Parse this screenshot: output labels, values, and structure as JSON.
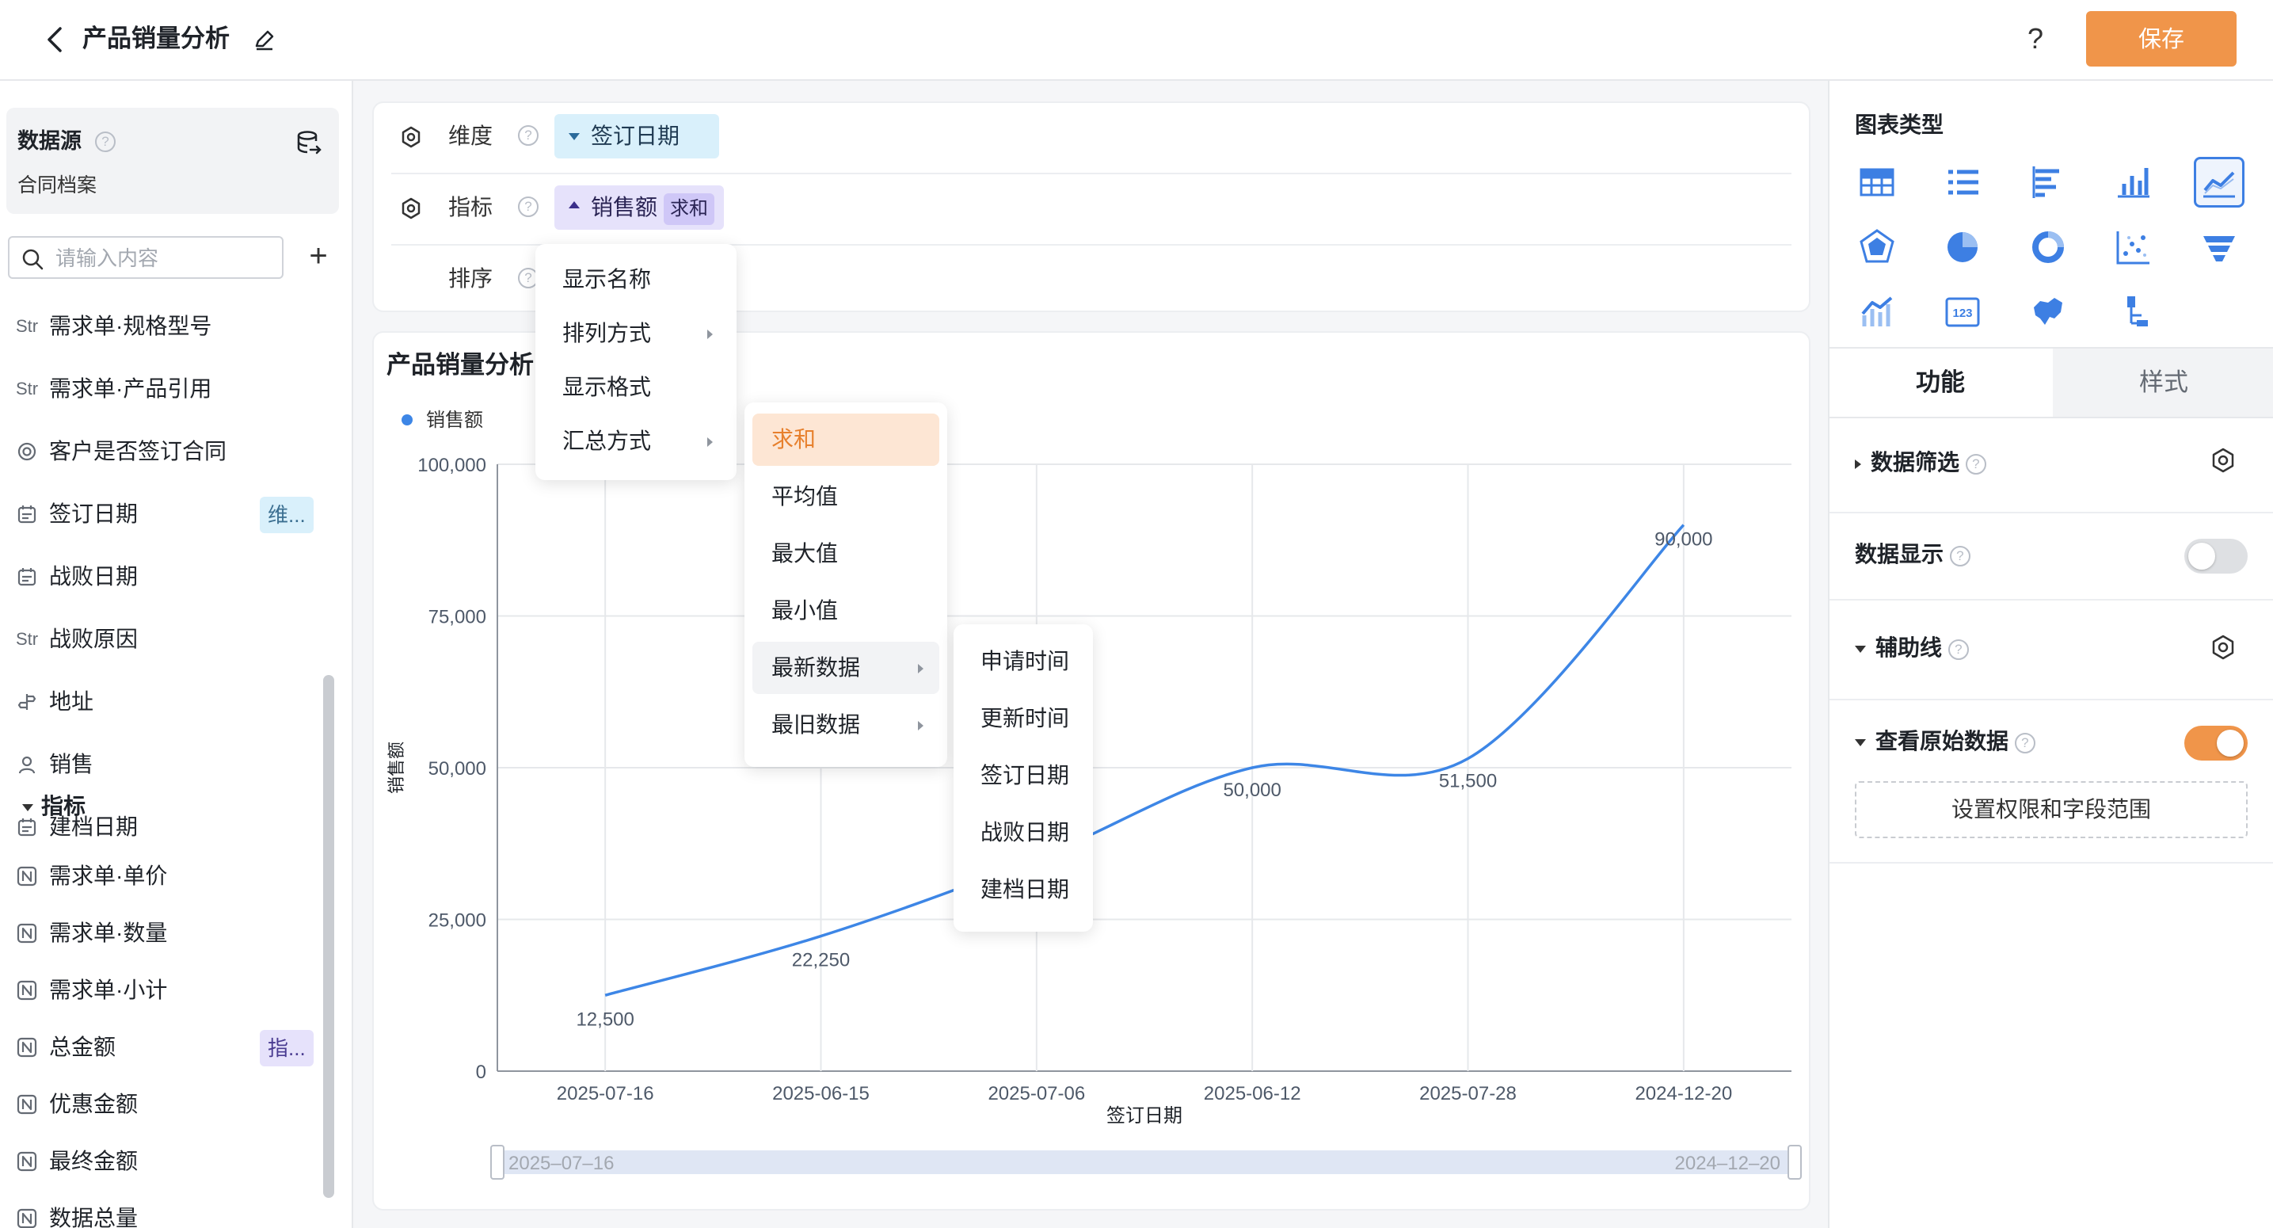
{
  "header": {
    "title": "产品销量分析",
    "help": "?",
    "save_label": "保存"
  },
  "datasource": {
    "title": "数据源",
    "help": "?",
    "name": "合同档案"
  },
  "search": {
    "placeholder": "请输入内容"
  },
  "fields": [
    {
      "type": "Str",
      "label": "需求单·规格型号",
      "tag": ""
    },
    {
      "type": "Str",
      "label": "需求单·产品引用",
      "tag": ""
    },
    {
      "type": "radio",
      "label": "客户是否签订合同",
      "tag": ""
    },
    {
      "type": "date",
      "label": "签订日期",
      "tag": "维..."
    },
    {
      "type": "date",
      "label": "战败日期",
      "tag": ""
    },
    {
      "type": "Str",
      "label": "战败原因",
      "tag": ""
    },
    {
      "type": "address",
      "label": "地址",
      "tag": ""
    },
    {
      "type": "user",
      "label": "销售",
      "tag": ""
    },
    {
      "type": "date",
      "label": "建档日期",
      "tag": ""
    }
  ],
  "metrics_group": {
    "title": "指标"
  },
  "metrics": [
    {
      "label": "需求单·单价",
      "tag": ""
    },
    {
      "label": "需求单·数量",
      "tag": ""
    },
    {
      "label": "需求单·小计",
      "tag": ""
    },
    {
      "label": "总金额",
      "tag": "指..."
    },
    {
      "label": "优惠金额",
      "tag": ""
    },
    {
      "label": "最终金额",
      "tag": ""
    },
    {
      "label": "数据总量",
      "tag": ""
    }
  ],
  "config": {
    "dimension_label": "维度",
    "dimension_value": "签订日期",
    "metric_label": "指标",
    "metric_value": "销售额",
    "metric_agg": "求和",
    "sort_label": "排序",
    "help": "?"
  },
  "metric_menu": [
    "显示名称",
    "排列方式",
    "显示格式",
    "汇总方式"
  ],
  "agg_menu": [
    "求和",
    "平均值",
    "最大值",
    "最小值",
    "最新数据",
    "最旧数据"
  ],
  "field_menu": [
    "申请时间",
    "更新时间",
    "签订日期",
    "战败日期",
    "建档日期"
  ],
  "chart_data": {
    "type": "line",
    "title": "产品销量分析",
    "legend": "top-left",
    "xlabel": "签订日期",
    "ylabel": "销售额",
    "categories": [
      "2025-07-16",
      "2025-06-15",
      "2025-07-06",
      "2025-06-12",
      "2025-07-28",
      "2024-12-20"
    ],
    "series": [
      {
        "name": "销售额",
        "values": [
          12500,
          22250,
          35000,
          50000,
          51500,
          90000
        ]
      }
    ],
    "data_labels": [
      "12,500",
      "22,250",
      "",
      "50,000",
      "51,500",
      "90,000"
    ],
    "ylim": [
      0,
      100000
    ],
    "yticks": [
      "100,000",
      "75,000",
      "50,000",
      "25,000",
      "0"
    ],
    "grid": true,
    "color": "#3d86e6",
    "zoom_start": "2025–07–16",
    "zoom_end": "2024–12–20"
  },
  "right_panel": {
    "chart_type_title": "图表类型",
    "chart_types": [
      "table-icon",
      "list-icon",
      "bar-horizontal-icon",
      "bar-vertical-icon",
      "line-chart-icon",
      "radar-icon",
      "pie-icon",
      "donut-icon",
      "scatter-icon",
      "funnel-icon",
      "combo-chart-icon",
      "number-card-icon",
      "map-icon",
      "tree-icon"
    ],
    "active_chart_type": "line-chart-icon",
    "tab_function": "功能",
    "tab_style": "样式",
    "filter_label": "数据筛选",
    "data_display_label": "数据显示",
    "aux_line_label": "辅助线",
    "raw_data_label": "查看原始数据",
    "permission_button": "设置权限和字段范围",
    "help": "?",
    "data_display_on": false,
    "raw_data_on": true
  }
}
